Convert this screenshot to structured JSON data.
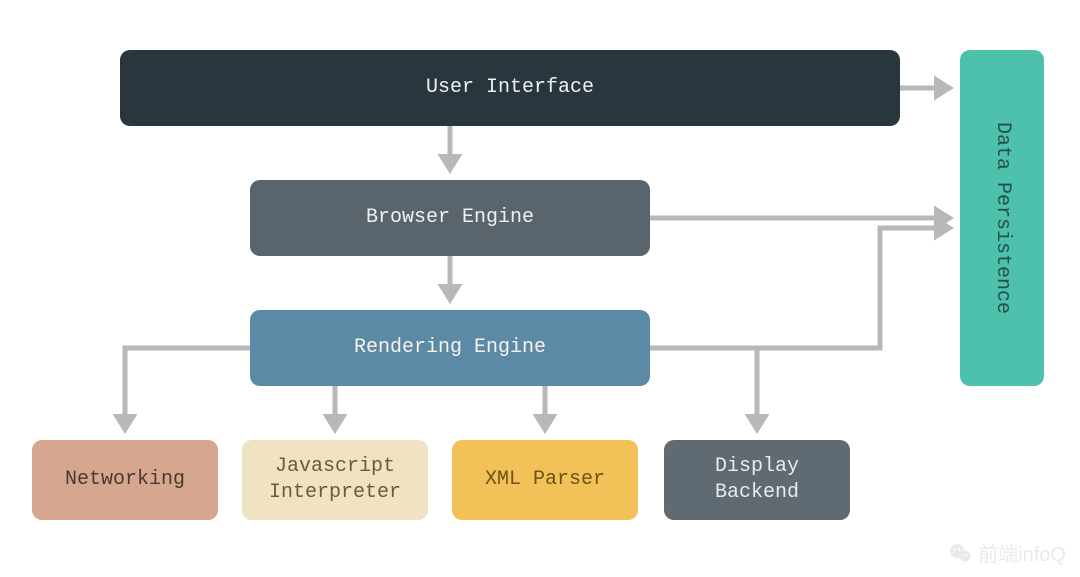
{
  "nodes": {
    "ui": "User Interface",
    "be": "Browser Engine",
    "re": "Rendering Engine",
    "net": "Networking",
    "js": "Javascript\nInterpreter",
    "xml": "XML Parser",
    "db": "Display\nBackend",
    "dp": "Data Persistence"
  },
  "edges": [
    {
      "from": "ui",
      "to": "be"
    },
    {
      "from": "ui",
      "to": "dp"
    },
    {
      "from": "be",
      "to": "re"
    },
    {
      "from": "be",
      "to": "dp"
    },
    {
      "from": "re",
      "to": "net"
    },
    {
      "from": "re",
      "to": "js"
    },
    {
      "from": "re",
      "to": "xml"
    },
    {
      "from": "re",
      "to": "db"
    },
    {
      "from": "re",
      "to": "dp"
    }
  ],
  "watermark": "前端infoQ",
  "colors": {
    "ui_bg": "#29363d",
    "be_bg": "#5a646c",
    "re_bg": "#5b8aa6",
    "net_bg": "#d7a68e",
    "js_bg": "#efe3c1",
    "xml_bg": "#f2c158",
    "db_bg": "#606a72",
    "dp_bg": "#4ec1ad",
    "arrow": "#b6b8ba"
  }
}
